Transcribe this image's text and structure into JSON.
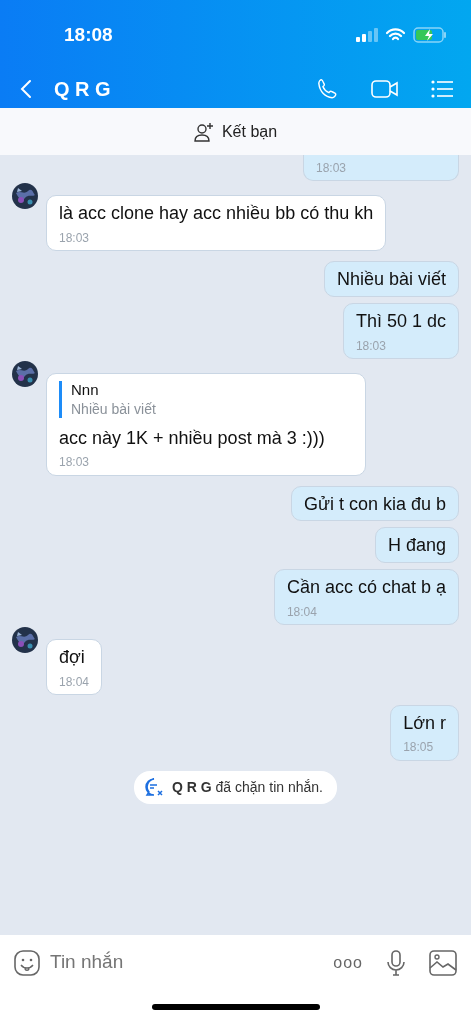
{
  "status_bar": {
    "time": "18:08"
  },
  "header": {
    "title": "Q R G"
  },
  "add_friend": {
    "label": "Kết bạn"
  },
  "messages": [
    {
      "kind": "outgoing",
      "time": "18:03",
      "cut": true
    },
    {
      "kind": "incoming",
      "text": "là acc clone hay acc nhiều bb có thu kh",
      "time": "18:03"
    },
    {
      "kind": "outgoing",
      "text": "Nhiều bài viết"
    },
    {
      "kind": "outgoing",
      "text": "Thì 50 1 dc",
      "time": "18:03"
    },
    {
      "kind": "incoming",
      "quote": {
        "author": "Nnn",
        "text": "Nhiều bài viết"
      },
      "text": "acc này 1K + nhiều post mà 3 :)))",
      "time": "18:03"
    },
    {
      "kind": "outgoing",
      "text": "Gửi t con kia đu b"
    },
    {
      "kind": "outgoing",
      "text": "H đang"
    },
    {
      "kind": "outgoing",
      "text": "Cần acc có chat b ạ",
      "time": "18:04"
    },
    {
      "kind": "incoming",
      "text": "đợi",
      "time": "18:04"
    },
    {
      "kind": "outgoing",
      "text": "Lớn r",
      "time": "18:05"
    }
  ],
  "notice": {
    "text": "**Q R G** đã chặn tin nhắn."
  },
  "composer": {
    "placeholder": "Tin nhắn",
    "more": "ooo"
  }
}
